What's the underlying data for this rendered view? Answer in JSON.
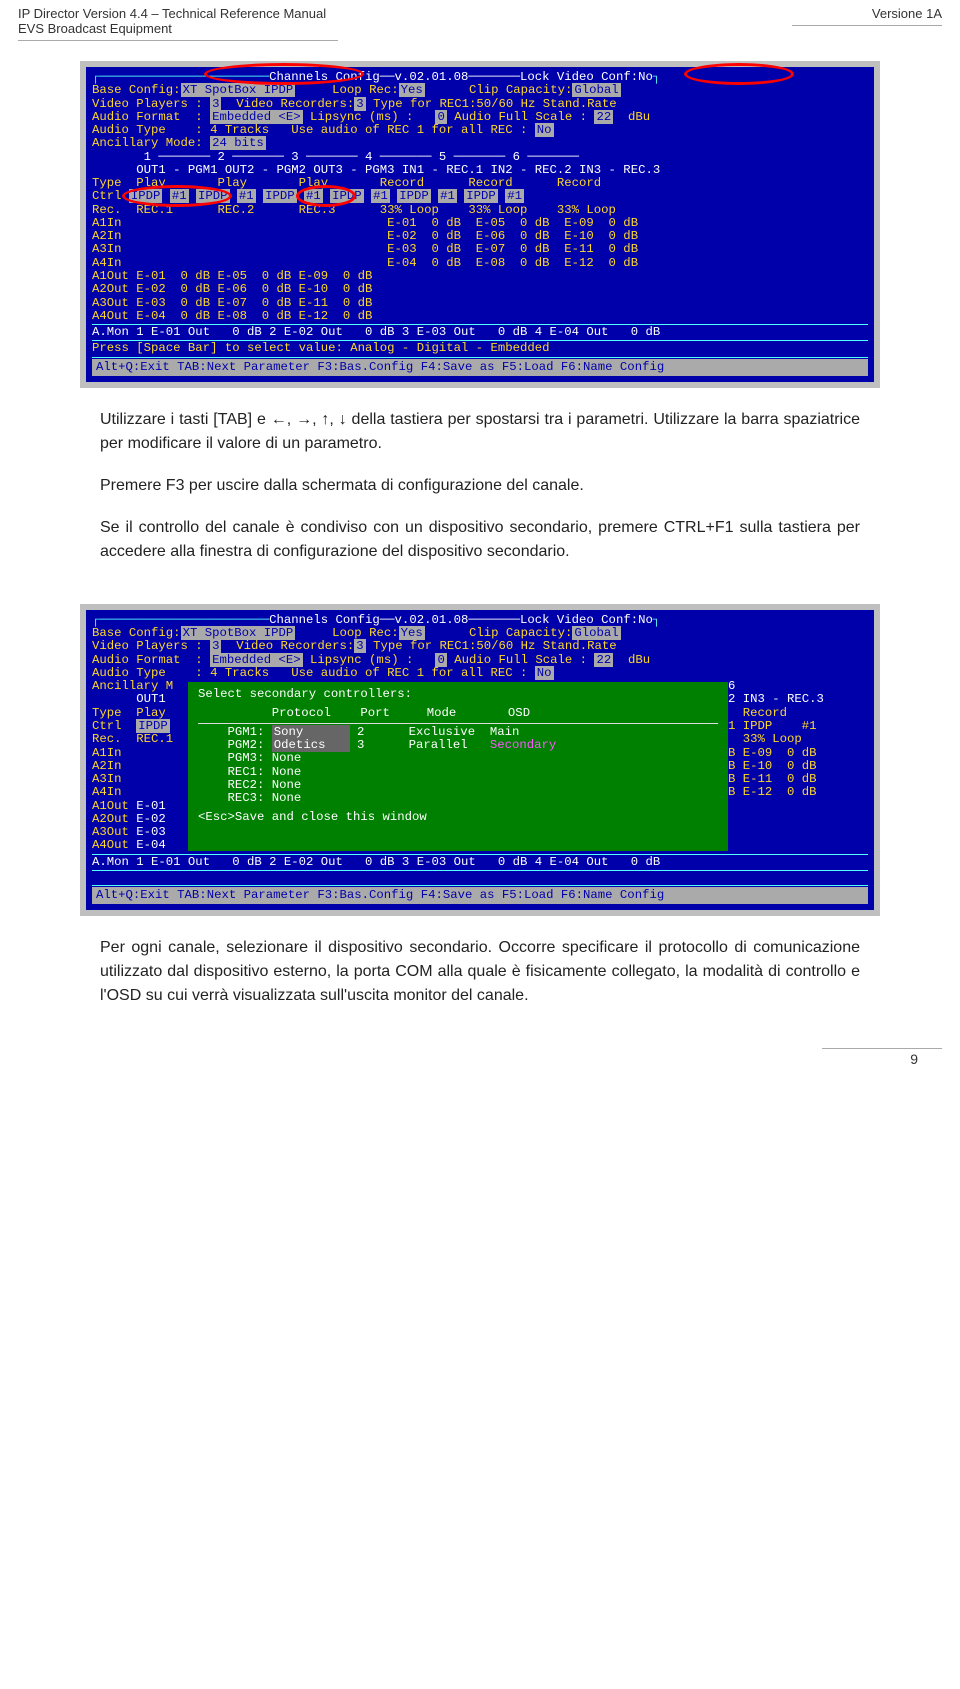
{
  "header": {
    "left1": "IP Director Version 4.4 – Technical Reference Manual",
    "left2": "EVS Broadcast Equipment",
    "right": "Versione 1A"
  },
  "screenshot1": {
    "title_line": "Channels Config──v.02.01.08───────Lock Video Conf:No",
    "base_config_label": "Base Config:",
    "base_config_value": "XT SpotBox IPDP",
    "loop_rec_label": "Loop Rec:",
    "loop_rec_value": "Yes",
    "clip_cap_label": "Clip Capacity:",
    "clip_cap_value": "Global",
    "video_players_label": "Video Players : ",
    "video_players_value": "3",
    "video_recorders_label": "  Video Recorders:",
    "video_recorders_value": "3",
    "type_rec_label": " Type for REC1:50/60 Hz Stand.Rate",
    "audio_format_label": "Audio Format  : ",
    "audio_format_value": "Embedded <E>",
    "lipsync_label": " Lipsync (ms) :   ",
    "lipsync_value": "0",
    "audio_full_label": " Audio Full Scale : ",
    "audio_full_value": "22",
    "audio_full_unit": "  dBu",
    "audio_type_label": "Audio Type    : 4 Tracks   Use audio of REC 1 for all REC : ",
    "audio_type_value": "No",
    "ancillary_label": "Ancillary Mode: ",
    "ancillary_value": "24 bits",
    "col_headers": "       1 ─────── 2 ─────── 3 ─────── 4 ─────── 5 ─────── 6 ───────",
    "out_row": "      OUT1 - PGM1 OUT2 - PGM2 OUT3 - PGM3 IN1 - REC.1 IN2 - REC.2 IN3 - REC.3",
    "type_row": "Type  Play       Play       Play       Record      Record      Record",
    "ctrl_label": "Ctrl ",
    "ctrl_values": [
      "IPDP",
      "#1",
      "IPDP",
      "#1",
      "IPDP",
      "#1",
      "IPDP",
      "#1",
      "IPDP",
      "#1",
      "IPDP",
      "#1"
    ],
    "rec_row": "Rec.  REC.1      REC.2      REC.3      33% Loop    33% Loop    33% Loop",
    "audio_in": [
      "A1In                                    E-01  0 dB  E-05  0 dB  E-09  0 dB",
      "A2In                                    E-02  0 dB  E-06  0 dB  E-10  0 dB",
      "A3In                                    E-03  0 dB  E-07  0 dB  E-11  0 dB",
      "A4In                                    E-04  0 dB  E-08  0 dB  E-12  0 dB"
    ],
    "audio_out": [
      "A1Out E-01  0 dB E-05  0 dB E-09  0 dB",
      "A2Out E-02  0 dB E-06  0 dB E-10  0 dB",
      "A3Out E-03  0 dB E-07  0 dB E-11  0 dB",
      "A4Out E-04  0 dB E-08  0 dB E-12  0 dB"
    ],
    "amon_row": "A.Mon 1 E-01 Out   0 dB 2 E-02 Out   0 dB 3 E-03 Out   0 dB 4 E-04 Out   0 dB",
    "prompt_row": "Press [Space Bar] to select value: Analog - Digital - Embedded",
    "footer": "Alt+Q:Exit TAB:Next Parameter F3:Bas.Config F4:Save as F5:Load F6:Name Config"
  },
  "body1": {
    "p1": "Utilizzare i tasti [TAB] e ←, →, ↑, ↓ della tastiera per spostarsi tra i parametri. Utilizzare la barra spaziatrice per modificare il valore di un parametro.",
    "p2": "Premere F3 per uscire dalla schermata di configurazione del canale.",
    "p3": "Se il controllo del canale è condiviso con un dispositivo secondario, premere CTRL+F1 sulla tastiera per accedere alla finestra di configurazione del dispositivo secondario."
  },
  "screenshot2": {
    "title_line": "Channels Config──v.02.01.08───────Lock Video Conf:No",
    "popup_title": "Select secondary controllers:",
    "popup_headers": "          Protocol    Port     Mode       OSD",
    "popup_rows": [
      {
        "label": "PGM1:",
        "protocol": "Sony",
        "port": "2",
        "mode": "Exclusive",
        "osd": "Main"
      },
      {
        "label": "PGM2:",
        "protocol": "Odetics",
        "port": "3",
        "mode": "Parallel",
        "osd": "Secondary"
      },
      {
        "label": "PGM3:",
        "protocol": "None",
        "port": "",
        "mode": "",
        "osd": ""
      },
      {
        "label": "REC1:",
        "protocol": "None",
        "port": "",
        "mode": "",
        "osd": ""
      },
      {
        "label": "REC2:",
        "protocol": "None",
        "port": "",
        "mode": "",
        "osd": ""
      },
      {
        "label": "REC3:",
        "protocol": "None",
        "port": "",
        "mode": "",
        "osd": ""
      }
    ],
    "popup_footer": "<Esc>Save and close this window",
    "left_col": [
      "Type",
      "Ctrl",
      "Rec.",
      "A1In",
      "A2In",
      "A3In",
      "A4In",
      "A1Out",
      "A2Out",
      "A3Out",
      "A4Out"
    ],
    "left_vals": [
      "OUT1",
      "Play",
      "IPDP",
      "REC.1",
      "",
      "",
      "",
      "",
      "E-01",
      "E-02",
      "E-03",
      "E-04"
    ],
    "right_summary": [
      "6",
      "2 IN3 - REC.3",
      "  Record",
      "1 IPDP    #1",
      "  33% Loop",
      "B E-09  0 dB",
      "B E-10  0 dB",
      "B E-11  0 dB",
      "B E-12  0 dB"
    ],
    "amon_row": "A.Mon 1 E-01 Out   0 dB 2 E-02 Out   0 dB 3 E-03 Out   0 dB 4 E-04 Out   0 dB",
    "footer": "Alt+Q:Exit TAB:Next Parameter F3:Bas.Config F4:Save as F5:Load F6:Name Config"
  },
  "body2": {
    "p1": "Per ogni canale, selezionare il dispositivo secondario. Occorre specificare il protocollo di comunicazione utilizzato dal dispositivo esterno, la porta COM alla quale è fisicamente collegato, la modalità di controllo e l'OSD su cui verrà visualizzata sull'uscita monitor del canale."
  },
  "page_num": "9"
}
